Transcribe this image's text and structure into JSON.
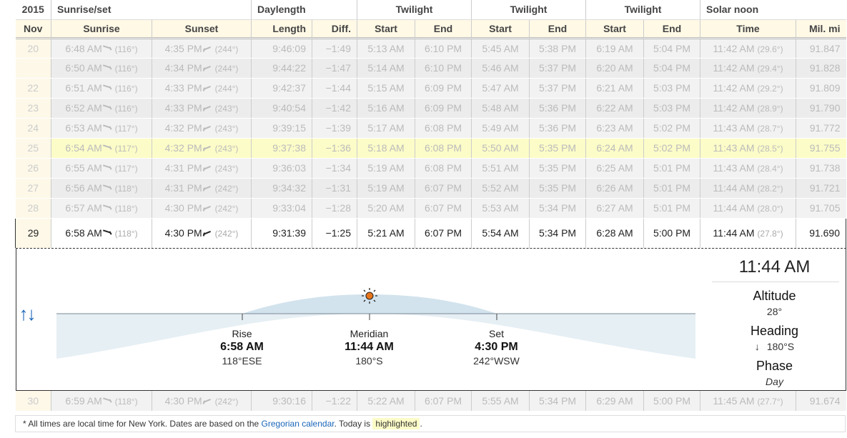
{
  "header": {
    "year": "2015",
    "groups": [
      "Sunrise/set",
      "Daylength",
      "Twilight",
      "Twilight",
      "Twilight",
      "Solar noon"
    ],
    "month": "Nov",
    "columns": [
      "Sunrise",
      "Sunset",
      "Length",
      "Diff.",
      "Start",
      "End",
      "Start",
      "End",
      "Start",
      "End",
      "Time",
      "Mil. mi"
    ]
  },
  "rows_before": [
    {
      "day": "20",
      "sunrise": "6:48 AM",
      "rise_deg": "(116°)",
      "sunset": "4:35 PM",
      "set_deg": "(244°)",
      "length": "9:46:09",
      "diff": "−1:49",
      "t1s": "5:13 AM",
      "t1e": "6:10 PM",
      "t2s": "5:45 AM",
      "t2e": "5:38 PM",
      "t3s": "6:19 AM",
      "t3e": "5:04 PM",
      "noon": "11:42 AM",
      "noon_deg": "(29.6°)",
      "mil": "91.847"
    },
    {
      "day": "",
      "sunrise": "6:50 AM",
      "rise_deg": "(116°)",
      "sunset": "4:34 PM",
      "set_deg": "(244°)",
      "length": "9:44:22",
      "diff": "−1:47",
      "t1s": "5:14 AM",
      "t1e": "6:10 PM",
      "t2s": "5:46 AM",
      "t2e": "5:37 PM",
      "t3s": "6:20 AM",
      "t3e": "5:04 PM",
      "noon": "11:42 AM",
      "noon_deg": "(29.4°)",
      "mil": "91.828"
    },
    {
      "day": "22",
      "sunrise": "6:51 AM",
      "rise_deg": "(116°)",
      "sunset": "4:33 PM",
      "set_deg": "(244°)",
      "length": "9:42:37",
      "diff": "−1:44",
      "t1s": "5:15 AM",
      "t1e": "6:09 PM",
      "t2s": "5:47 AM",
      "t2e": "5:37 PM",
      "t3s": "6:21 AM",
      "t3e": "5:03 PM",
      "noon": "11:42 AM",
      "noon_deg": "(29.2°)",
      "mil": "91.809"
    },
    {
      "day": "23",
      "sunrise": "6:52 AM",
      "rise_deg": "(116°)",
      "sunset": "4:33 PM",
      "set_deg": "(243°)",
      "length": "9:40:54",
      "diff": "−1:42",
      "t1s": "5:16 AM",
      "t1e": "6:09 PM",
      "t2s": "5:48 AM",
      "t2e": "5:36 PM",
      "t3s": "6:22 AM",
      "t3e": "5:03 PM",
      "noon": "11:42 AM",
      "noon_deg": "(28.9°)",
      "mil": "91.790"
    },
    {
      "day": "24",
      "sunrise": "6:53 AM",
      "rise_deg": "(117°)",
      "sunset": "4:32 PM",
      "set_deg": "(243°)",
      "length": "9:39:15",
      "diff": "−1:39",
      "t1s": "5:17 AM",
      "t1e": "6:08 PM",
      "t2s": "5:49 AM",
      "t2e": "5:36 PM",
      "t3s": "6:23 AM",
      "t3e": "5:02 PM",
      "noon": "11:43 AM",
      "noon_deg": "(28.7°)",
      "mil": "91.772"
    },
    {
      "day": "25",
      "sunrise": "6:54 AM",
      "rise_deg": "(117°)",
      "sunset": "4:32 PM",
      "set_deg": "(243°)",
      "length": "9:37:38",
      "diff": "−1:36",
      "t1s": "5:18 AM",
      "t1e": "6:08 PM",
      "t2s": "5:50 AM",
      "t2e": "5:35 PM",
      "t3s": "6:24 AM",
      "t3e": "5:02 PM",
      "noon": "11:43 AM",
      "noon_deg": "(28.5°)",
      "mil": "91.755"
    },
    {
      "day": "26",
      "sunrise": "6:55 AM",
      "rise_deg": "(117°)",
      "sunset": "4:31 PM",
      "set_deg": "(243°)",
      "length": "9:36:03",
      "diff": "−1:34",
      "t1s": "5:19 AM",
      "t1e": "6:08 PM",
      "t2s": "5:51 AM",
      "t2e": "5:35 PM",
      "t3s": "6:25 AM",
      "t3e": "5:01 PM",
      "noon": "11:43 AM",
      "noon_deg": "(28.4°)",
      "mil": "91.738"
    },
    {
      "day": "27",
      "sunrise": "6:56 AM",
      "rise_deg": "(118°)",
      "sunset": "4:31 PM",
      "set_deg": "(242°)",
      "length": "9:34:32",
      "diff": "−1:31",
      "t1s": "5:19 AM",
      "t1e": "6:07 PM",
      "t2s": "5:52 AM",
      "t2e": "5:35 PM",
      "t3s": "6:26 AM",
      "t3e": "5:01 PM",
      "noon": "11:44 AM",
      "noon_deg": "(28.2°)",
      "mil": "91.721"
    },
    {
      "day": "28",
      "sunrise": "6:57 AM",
      "rise_deg": "(118°)",
      "sunset": "4:30 PM",
      "set_deg": "(242°)",
      "length": "9:33:04",
      "diff": "−1:28",
      "t1s": "5:20 AM",
      "t1e": "6:07 PM",
      "t2s": "5:53 AM",
      "t2e": "5:34 PM",
      "t3s": "6:27 AM",
      "t3e": "5:01 PM",
      "noon": "11:44 AM",
      "noon_deg": "(28.0°)",
      "mil": "91.705"
    }
  ],
  "current": {
    "day": "29",
    "sunrise": "6:58 AM",
    "rise_deg": "(118°)",
    "sunset": "4:30 PM",
    "set_deg": "(242°)",
    "length": "9:31:39",
    "diff": "−1:25",
    "t1s": "5:21 AM",
    "t1e": "6:07 PM",
    "t2s": "5:54 AM",
    "t2e": "5:34 PM",
    "t3s": "6:28 AM",
    "t3e": "5:00 PM",
    "noon": "11:44 AM",
    "noon_deg": "(27.8°)",
    "mil": "91.690"
  },
  "detail": {
    "rise_label": "Rise",
    "rise_time": "6:58 AM",
    "rise_dir": "118°ESE",
    "meridian_label": "Meridian",
    "meridian_time": "11:44 AM",
    "meridian_dir": "180°S",
    "set_label": "Set",
    "set_time": "4:30 PM",
    "set_dir": "242°WSW",
    "panel_time": "11:44 AM",
    "altitude_label": "Altitude",
    "altitude_value": "28°",
    "heading_label": "Heading",
    "heading_value": "180°S",
    "phase_label": "Phase",
    "phase_value": "Day",
    "toggle_icon": "↑↓"
  },
  "rows_after": [
    {
      "day": "30",
      "sunrise": "6:59 AM",
      "rise_deg": "(118°)",
      "sunset": "4:30 PM",
      "set_deg": "(242°)",
      "length": "9:30:16",
      "diff": "−1:22",
      "t1s": "5:22 AM",
      "t1e": "6:07 PM",
      "t2s": "5:55 AM",
      "t2e": "5:34 PM",
      "t3s": "6:29 AM",
      "t3e": "5:00 PM",
      "noon": "11:45 AM",
      "noon_deg": "(27.7°)",
      "mil": "91.674"
    }
  ],
  "footer": {
    "text1": "* All times are local time for New York. Dates are based on the",
    "link": "Gregorian calendar",
    "text2": ". Today is",
    "highlighted": "highlighted",
    "text3": "."
  },
  "colors": {
    "highlight": "#fcfcc8",
    "link": "#1a66b8",
    "sky": "#d7e7f0"
  }
}
